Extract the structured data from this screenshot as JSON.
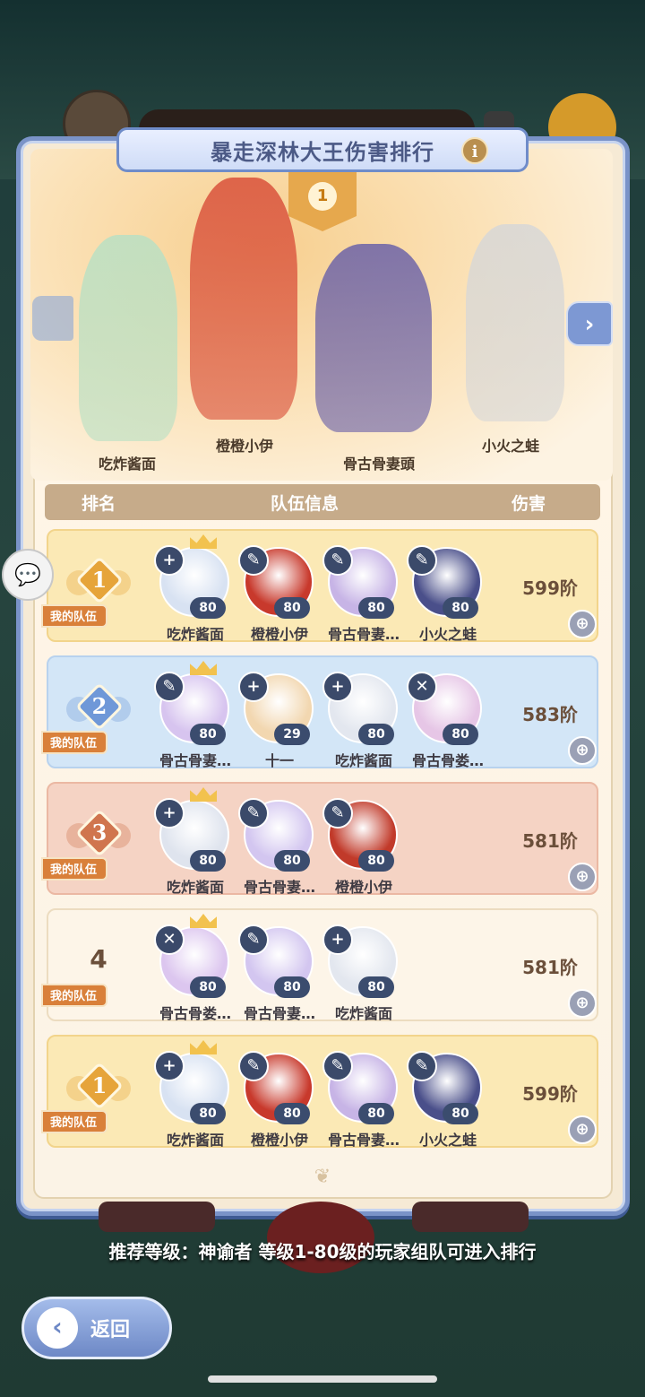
{
  "panel": {
    "title": "暴走深林大王伤害排行",
    "info_icon": "i",
    "top_rank": "1"
  },
  "heroes": [
    {
      "name": "吃炸酱面",
      "color": "#b9e0c4"
    },
    {
      "name": "橙橙小伊",
      "color": "#d9503a"
    },
    {
      "name": "骨古骨妻頭",
      "color": "#6b62a8"
    },
    {
      "name": "小火之蛙",
      "color": "#d7d7d7"
    }
  ],
  "nav": {
    "right_arrow": "›"
  },
  "table": {
    "headers": {
      "rank": "排名",
      "team": "队伍信息",
      "damage": "伤害"
    },
    "my_team_label": "我的队伍",
    "rows": [
      {
        "rank": "1",
        "style": "gold",
        "damage": "599阶",
        "members": [
          {
            "name": "吃炸酱面",
            "level": "80",
            "cls": "+",
            "color": "#d8e2f2",
            "crown": true
          },
          {
            "name": "橙橙小伊",
            "level": "80",
            "cls": "✎",
            "color": "#c8392c",
            "crown": false
          },
          {
            "name": "骨古骨妻…",
            "level": "80",
            "cls": "✎",
            "color": "#c7b4e6",
            "crown": false
          },
          {
            "name": "小火之蛙",
            "level": "80",
            "cls": "✎",
            "color": "#4a4f8a",
            "crown": false
          }
        ]
      },
      {
        "rank": "2",
        "style": "blue",
        "damage": "583阶",
        "members": [
          {
            "name": "骨古骨妻…",
            "level": "80",
            "cls": "✎",
            "color": "#d7c4ef",
            "crown": true
          },
          {
            "name": "十一",
            "level": "29",
            "cls": "+",
            "color": "#f2d7b0",
            "crown": false
          },
          {
            "name": "吃炸酱面",
            "level": "80",
            "cls": "+",
            "color": "#e3e7ef",
            "crown": false
          },
          {
            "name": "骨古骨娄…",
            "level": "80",
            "cls": "✕",
            "color": "#e6c6e6",
            "crown": false
          }
        ]
      },
      {
        "rank": "3",
        "style": "red",
        "damage": "581阶",
        "members": [
          {
            "name": "吃炸酱面",
            "level": "80",
            "cls": "+",
            "color": "#dfe4ee",
            "crown": true
          },
          {
            "name": "骨古骨妻…",
            "level": "80",
            "cls": "✎",
            "color": "#d3c6f0",
            "crown": false
          },
          {
            "name": "橙橙小伊",
            "level": "80",
            "cls": "✎",
            "color": "#c13a2a",
            "crown": false
          }
        ]
      },
      {
        "rank": "4",
        "style": "white",
        "damage": "581阶",
        "members": [
          {
            "name": "骨古骨娄…",
            "level": "80",
            "cls": "✕",
            "color": "#dcc6ef",
            "crown": true
          },
          {
            "name": "骨古骨妻…",
            "level": "80",
            "cls": "✎",
            "color": "#d3c6f0",
            "crown": false
          },
          {
            "name": "吃炸酱面",
            "level": "80",
            "cls": "+",
            "color": "#e3e7ef",
            "crown": false
          }
        ]
      },
      {
        "rank": "1",
        "style": "gold",
        "damage": "599阶",
        "members": [
          {
            "name": "吃炸酱面",
            "level": "80",
            "cls": "+",
            "color": "#d8e2f2",
            "crown": true
          },
          {
            "name": "橙橙小伊",
            "level": "80",
            "cls": "✎",
            "color": "#c8392c",
            "crown": false
          },
          {
            "name": "骨古骨妻…",
            "level": "80",
            "cls": "✎",
            "color": "#c7b4e6",
            "crown": false
          },
          {
            "name": "小火之蛙",
            "level": "80",
            "cls": "✎",
            "color": "#4a4f8a",
            "crown": false
          }
        ]
      }
    ]
  },
  "hint": "推荐等级：神谕者  等级1-80级的玩家组队可进入排行",
  "back": {
    "label": "返回",
    "icon": "‹"
  },
  "colors": {
    "gold_medal": "#e6a43a",
    "silver_medal": "#6f98d8",
    "bronze_medal": "#d0754e"
  }
}
